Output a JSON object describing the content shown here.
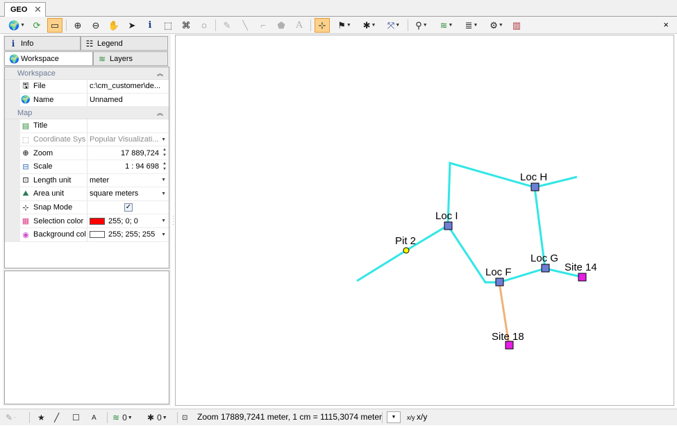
{
  "document_tab": {
    "title": "GEO",
    "close": "✕"
  },
  "toolbar": {
    "close": "×",
    "buttons": [
      {
        "icon": "globe-icon",
        "glyph": "🌍"
      },
      {
        "icon": "refresh-icon",
        "glyph": "⟳"
      },
      {
        "icon": "panel-toggle-icon",
        "glyph": "▭"
      },
      {
        "icon": "zoom-in-icon",
        "glyph": "⊕"
      },
      {
        "icon": "zoom-out-icon",
        "glyph": "⊖"
      },
      {
        "icon": "pan-hand-icon",
        "glyph": "✋"
      },
      {
        "icon": "select-arrow-icon",
        "glyph": "➤"
      },
      {
        "icon": "info-icon",
        "glyph": "i"
      },
      {
        "icon": "rect-select-icon",
        "glyph": "⬚"
      },
      {
        "icon": "lasso-select-icon",
        "glyph": "⌘"
      },
      {
        "icon": "circle-select-icon",
        "glyph": "◌"
      },
      {
        "icon": "add-point-icon",
        "glyph": "✎"
      },
      {
        "icon": "add-line-icon",
        "glyph": "╲"
      },
      {
        "icon": "add-polyline-icon",
        "glyph": "⌐"
      },
      {
        "icon": "add-polygon-icon",
        "glyph": "⬟"
      },
      {
        "icon": "add-text-icon",
        "glyph": "A"
      },
      {
        "icon": "snap-icon",
        "glyph": "⊹"
      },
      {
        "icon": "route-icon",
        "glyph": "⚑"
      },
      {
        "icon": "pointer-options-icon",
        "glyph": "✱"
      },
      {
        "icon": "measure-icon",
        "glyph": "⤧"
      },
      {
        "icon": "find-binoculars-icon",
        "glyph": "⚲"
      },
      {
        "icon": "layer-add-icon",
        "glyph": "≋"
      },
      {
        "icon": "layer-edit-icon",
        "glyph": "≣"
      },
      {
        "icon": "layer-style-icon",
        "glyph": "⚙"
      },
      {
        "icon": "map-book-icon",
        "glyph": "▥"
      }
    ]
  },
  "panel": {
    "tabs": {
      "info": "Info",
      "legend": "Legend",
      "workspace": "Workspace",
      "layers": "Layers"
    },
    "workspace_category": "Workspace",
    "map_category": "Map",
    "workspace_props": {
      "file_label": "File",
      "file_value": "c:\\cm_customer\\de...",
      "name_label": "Name",
      "name_value": "Unnamed"
    },
    "map_props": {
      "title_label": "Title",
      "title_value": "",
      "coord_label": "Coordinate Sys",
      "coord_value": "Popular Visualizati...",
      "zoom_label": "Zoom",
      "zoom_value": "17 889,724",
      "scale_label": "Scale",
      "scale_value": "1 : 94 698",
      "length_label": "Length unit",
      "length_value": "meter",
      "area_label": "Area unit",
      "area_value": "square meters",
      "snap_label": "Snap Mode",
      "snap_checked": "✓",
      "selection_label": "Selection color",
      "selection_value": "255; 0; 0",
      "selection_color": "#ff0000",
      "background_label": "Background col",
      "background_value": "255; 255; 255",
      "background_color": "#ffffff"
    }
  },
  "map": {
    "line_color": "#32e6e6",
    "highlight_line_color": "#f0b27a",
    "node_color": "#6f7fd6",
    "site_color": "#e61ee6",
    "pit_color": "#ffff00",
    "labels": {
      "loc_h": "Loc H",
      "loc_i": "Loc I",
      "pit_2": "Pit 2",
      "loc_g": "Loc G",
      "site_14": "Site 14",
      "loc_f": "Loc F",
      "site_18": "Site 18"
    }
  },
  "status": {
    "point_count": "0",
    "pointer_count": "0",
    "zoom_text": "Zoom 17889,7241 meter, 1 cm = 1115,3074 meter",
    "xy_text": "x/y"
  }
}
